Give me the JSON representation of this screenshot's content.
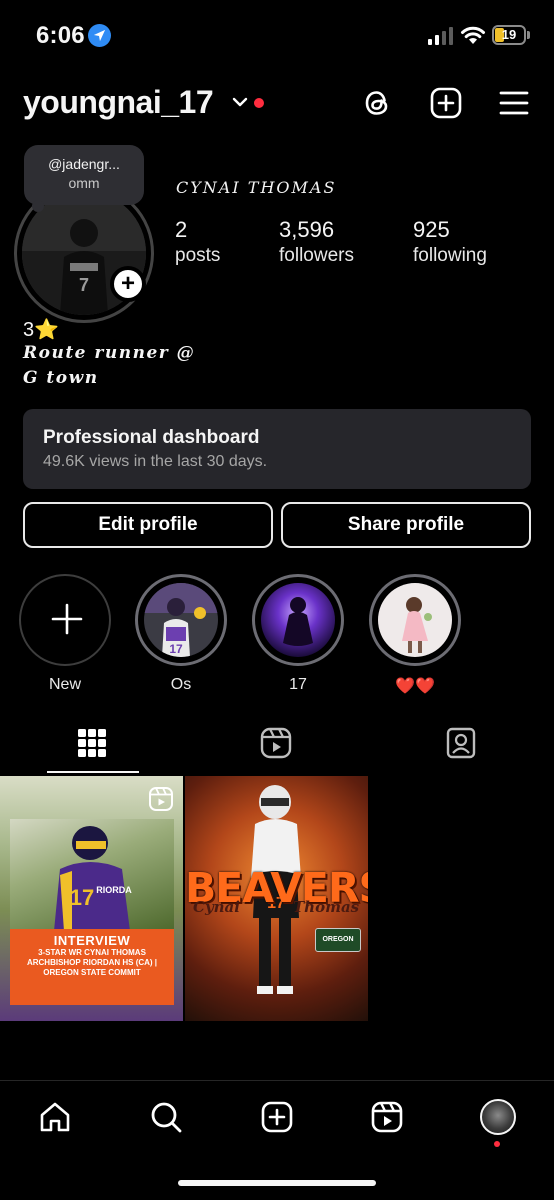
{
  "status_bar": {
    "time": "6:06",
    "battery": "19",
    "battery_color": "#f0c02a",
    "icons": [
      "location-arrow-icon",
      "cellular-signal-icon",
      "wifi-icon",
      "battery-icon"
    ]
  },
  "header": {
    "username": "youngnai_17",
    "icons": [
      "chevron-down-icon",
      "threads-icon",
      "create-icon",
      "menu-icon"
    ],
    "unread_dot_color": "#ff2d3f"
  },
  "note": {
    "handle": "@jadengr...",
    "text": "omm"
  },
  "profile": {
    "display_name": "CYNAI THOMAS",
    "stats": [
      {
        "value": "2",
        "label": "posts"
      },
      {
        "value": "3,596",
        "label": "followers"
      },
      {
        "value": "925",
        "label": "following"
      }
    ],
    "bio_rating": "3⭐",
    "bio_line1": "Route runner @",
    "bio_line2": "G town"
  },
  "dashboard": {
    "title": "Professional dashboard",
    "subtitle": "49.6K views in the last 30 days."
  },
  "buttons": {
    "edit": "Edit profile",
    "share": "Share profile"
  },
  "highlights": [
    {
      "label": "New"
    },
    {
      "label": "Os"
    },
    {
      "label": "17"
    },
    {
      "label": "❤️❤️"
    }
  ],
  "tabs": [
    "grid-icon",
    "reels-icon",
    "tagged-icon"
  ],
  "posts": {
    "post1": {
      "banner_title": "INTERVIEW",
      "banner_line1": "3-STAR WR CYNAI THOMAS",
      "banner_line2": "ARCHBISHOP RIORDAN HS (CA) |",
      "banner_line3": "OREGON STATE COMMIT",
      "jersey_number": "17",
      "jersey_text": "RIORDA"
    },
    "post2": {
      "big_word": "BEAVERS",
      "first_name": "Cynai",
      "last_name": "Thomas",
      "sign_text": "OREGON",
      "jersey_number": "17"
    }
  },
  "bottom_nav": [
    "home-icon",
    "search-icon",
    "create-icon",
    "reels-icon",
    "profile-avatar"
  ],
  "colors": {
    "background": "#000000",
    "accent_red": "#ff2d3f",
    "card_bg": "#26262b",
    "beavers_orange": "#ff6a1a"
  }
}
